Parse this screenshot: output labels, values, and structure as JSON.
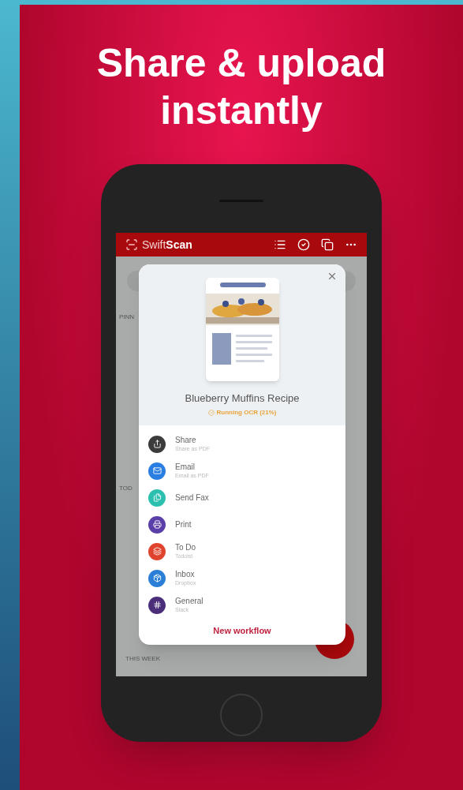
{
  "headline": "Share & upload instantly",
  "app": {
    "name_light": "Swift",
    "name_bold": "Scan"
  },
  "background_labels": [
    "PINN",
    "TOD",
    "THIS WEEK"
  ],
  "sheet": {
    "document_title": "Blueberry Muffins Recipe",
    "status": "Running OCR (21%)",
    "actions": [
      {
        "kind": "share",
        "label": "Share",
        "sublabel": "Share as PDF",
        "color": "#3b3b3b"
      },
      {
        "kind": "email",
        "label": "Email",
        "sublabel": "Email as PDF",
        "color": "#2a7de1"
      },
      {
        "kind": "fax",
        "label": "Send Fax",
        "color": "#2bbfb0"
      },
      {
        "kind": "print",
        "label": "Print",
        "color": "#5b3fa8"
      },
      {
        "kind": "todo",
        "label": "To Do",
        "sublabel": "Todoist",
        "color": "#e0442f"
      },
      {
        "kind": "dropbox",
        "label": "Inbox",
        "sublabel": "Dropbox",
        "color": "#2b7fd6"
      },
      {
        "kind": "slack",
        "label": "General",
        "sublabel": "Slack",
        "color": "#4a2e7a"
      }
    ],
    "footer_button": "New workflow"
  }
}
